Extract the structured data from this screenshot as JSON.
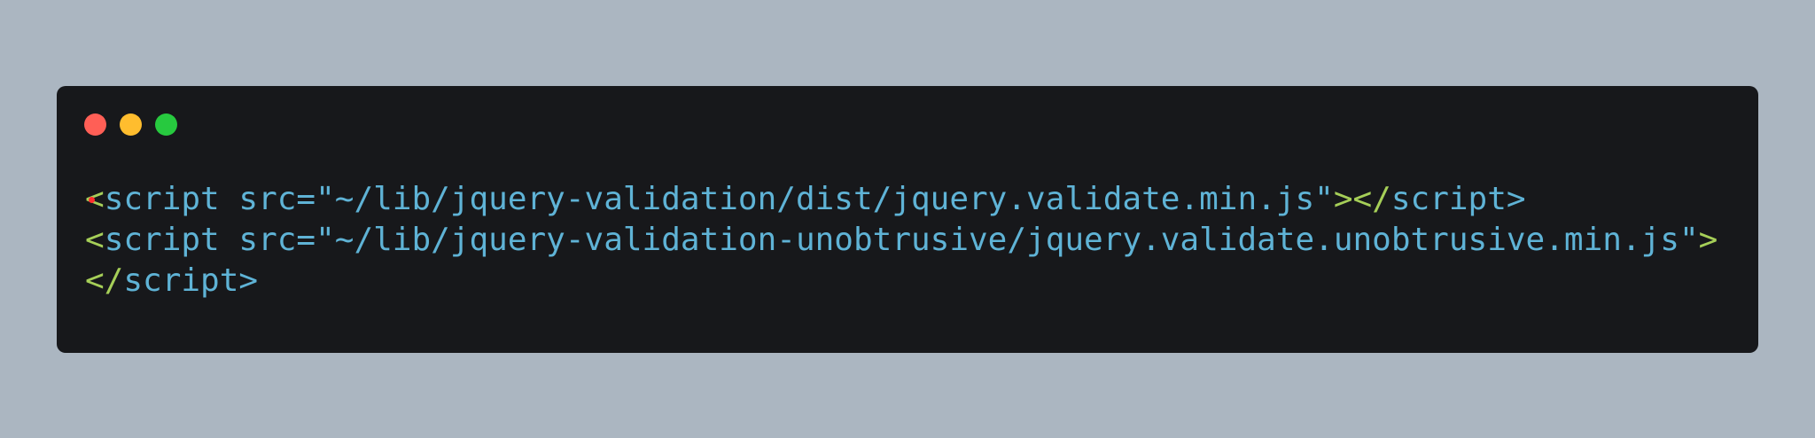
{
  "code": {
    "line1": {
      "open_bracket": "<",
      "text": "script src=\"~/lib/jquery-validation/dist/jquery.validate.min.js\"",
      "middle_tag": "></",
      "close_text": "script>"
    },
    "line2": {
      "open_bracket": "<",
      "text": "script src=\"~/lib/jquery-validation-unobtrusive/jquery.validate.unobtrusive.min.js\"",
      "close_bracket": ">"
    },
    "line3": {
      "open_tag": "</",
      "text": "script>"
    }
  },
  "colors": {
    "background": "#abb6c1",
    "window": "#17181b",
    "code_text": "#5fb3d6",
    "code_tag": "#a6cf58",
    "marker": "#ff2f2f"
  },
  "icons": {
    "window_controls": [
      "close-icon",
      "minimize-icon",
      "maximize-icon"
    ],
    "line_marker": "breakpoint-dot-icon"
  }
}
